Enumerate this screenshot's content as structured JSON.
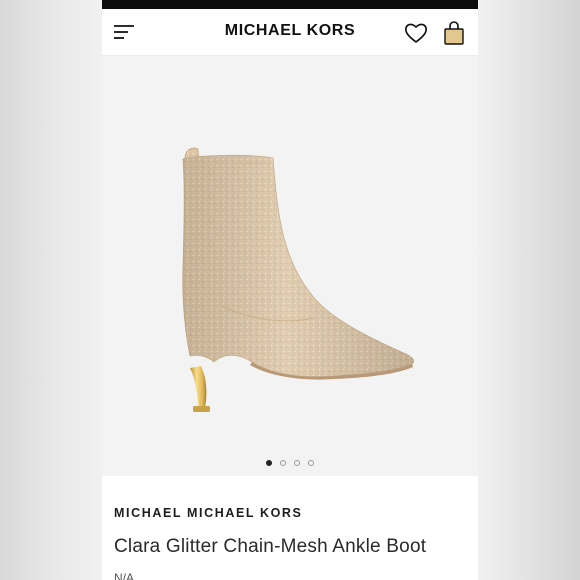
{
  "header": {
    "brand": "MICHAEL KORS",
    "menu_icon": "hamburger-menu-icon",
    "wishlist_icon": "heart-icon",
    "bag_icon": "shopping-bag-icon"
  },
  "gallery": {
    "image_description": "glitter chain-mesh ankle boot",
    "slide_count": 4,
    "active_slide": 1
  },
  "product": {
    "designer": "MICHAEL MICHAEL KORS",
    "name": "Clara Glitter Chain-Mesh Ankle Boot",
    "color": "N/A"
  },
  "colors": {
    "status_bar": "#0c0c0c",
    "text_primary": "#111111",
    "boot_base": "#dcc5a6",
    "heel_gold": "#e7c466"
  }
}
